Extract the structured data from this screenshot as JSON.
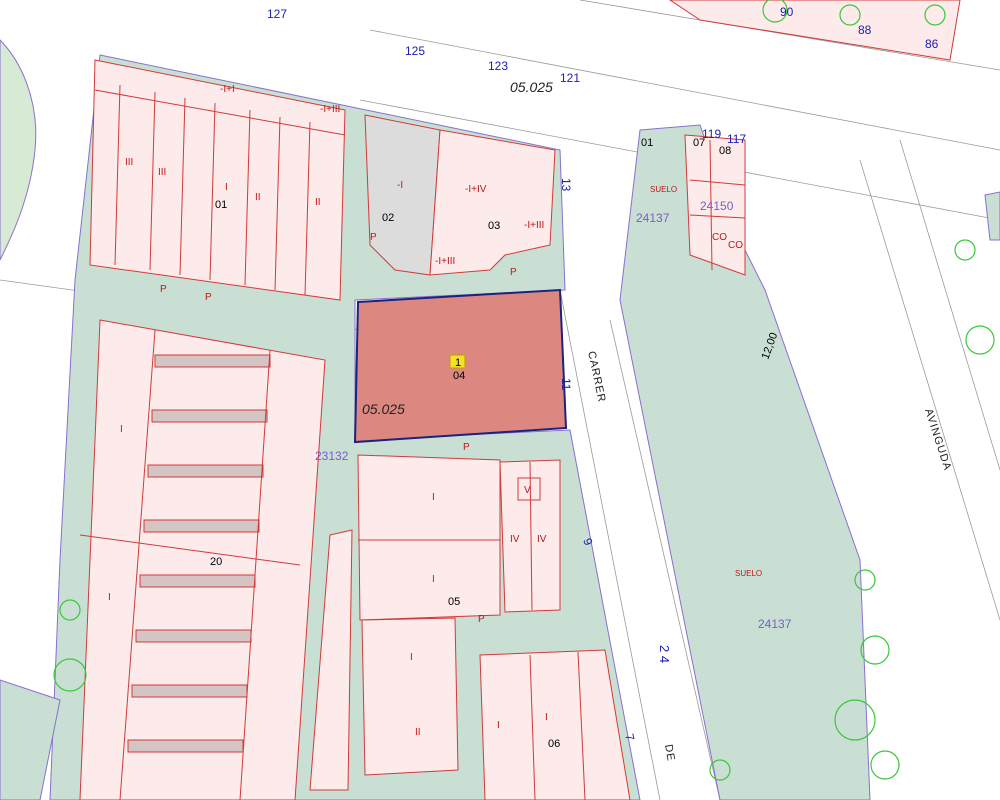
{
  "map": {
    "zone_code_top": "05.025",
    "zone_code_parcel": "05.025",
    "selected_parcel_number": "04",
    "selected_marker": "1",
    "blocks": {
      "left": "23132",
      "right": "24137",
      "right_small": "24137",
      "right_partial": "24150"
    },
    "parcel_numbers": [
      "01",
      "02",
      "03",
      "05",
      "06",
      "20",
      "01",
      "07",
      "08"
    ],
    "house_numbers": [
      "127",
      "125",
      "123",
      "121",
      "90",
      "88",
      "86",
      "13",
      "11",
      "9",
      "2 4",
      "7",
      "119",
      "117",
      "12,00"
    ],
    "streets": [
      "CARRER",
      "DE",
      "AVINGUDA"
    ],
    "land_label": "SUELO",
    "floor_labels": [
      "III",
      "-I+III",
      "-I+I",
      "-I+IV",
      "-I",
      "I",
      "II",
      "IV",
      "V",
      "P",
      "-I+II",
      "CO"
    ]
  }
}
